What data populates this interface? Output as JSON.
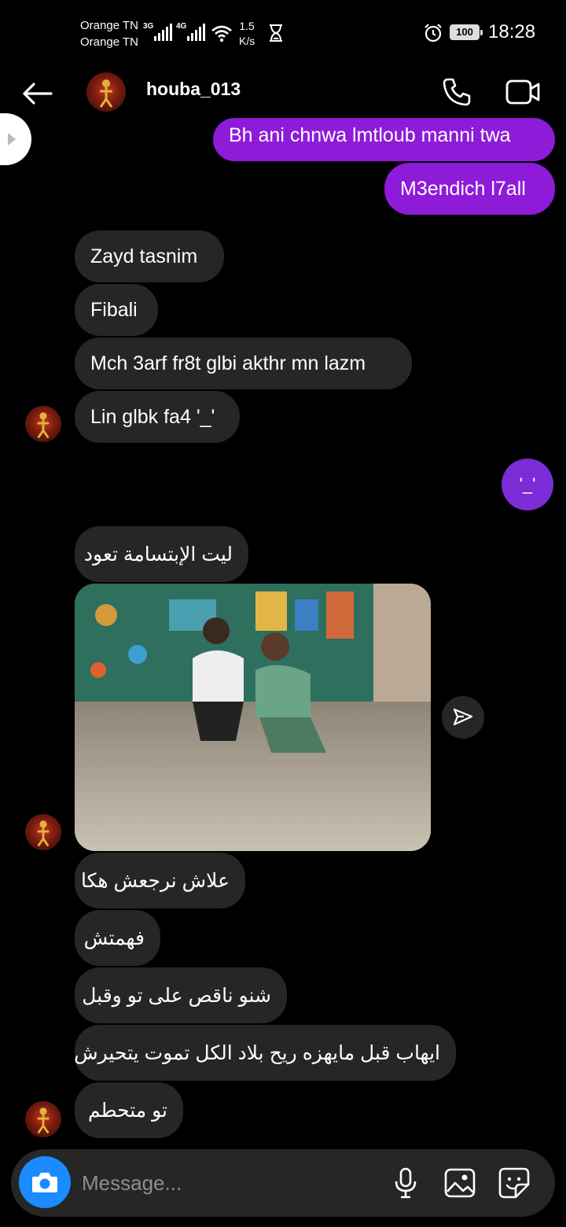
{
  "status_bar": {
    "carrier_1": "Orange TN",
    "carrier_2": "Orange TN",
    "net_1": "3G",
    "net_2": "4G",
    "speed_value": "1.5",
    "speed_unit": "K/s",
    "battery": "100",
    "time": "18:28"
  },
  "header": {
    "username": "houba_013"
  },
  "messages": [
    {
      "direction": "out",
      "text": "Bh ani chnwa lmtloub manni twa"
    },
    {
      "direction": "out",
      "text": "M3endich l7all"
    },
    {
      "direction": "in",
      "text": "Zayd tasnim"
    },
    {
      "direction": "in",
      "text": "Fibali"
    },
    {
      "direction": "in",
      "text": "Mch 3arf fr8t glbi akthr mn lazm"
    },
    {
      "direction": "in",
      "text": "Lin glbk fa4 '_'"
    },
    {
      "direction": "out",
      "text": "'_'"
    },
    {
      "direction": "in",
      "text": "ليت الإبتسامة تعود"
    },
    {
      "direction": "in",
      "type": "photo"
    },
    {
      "direction": "in",
      "text": "علاش نرجعش هكا"
    },
    {
      "direction": "in",
      "text": "فهمتش"
    },
    {
      "direction": "in",
      "text": "شنو ناقص على تو وقبل"
    },
    {
      "direction": "in",
      "text": "ايهاب قبل مايهزه ريح بلاد الكل تموت يتحيرش"
    },
    {
      "direction": "in",
      "text": "تو متحطم"
    }
  ],
  "composer": {
    "placeholder": "Message..."
  },
  "icons": {
    "back": "arrow-left-icon",
    "call": "phone-icon",
    "video": "video-camera-icon",
    "camera": "camera-icon",
    "mic": "microphone-icon",
    "gallery": "image-icon",
    "sticker": "sticker-icon",
    "share": "send-icon"
  },
  "colors": {
    "outgoing_bubble": "#8e1bd8",
    "incoming_bubble": "#262626",
    "emoji_bubble": "#7b2cd6",
    "camera_button": "#1a8cff"
  }
}
